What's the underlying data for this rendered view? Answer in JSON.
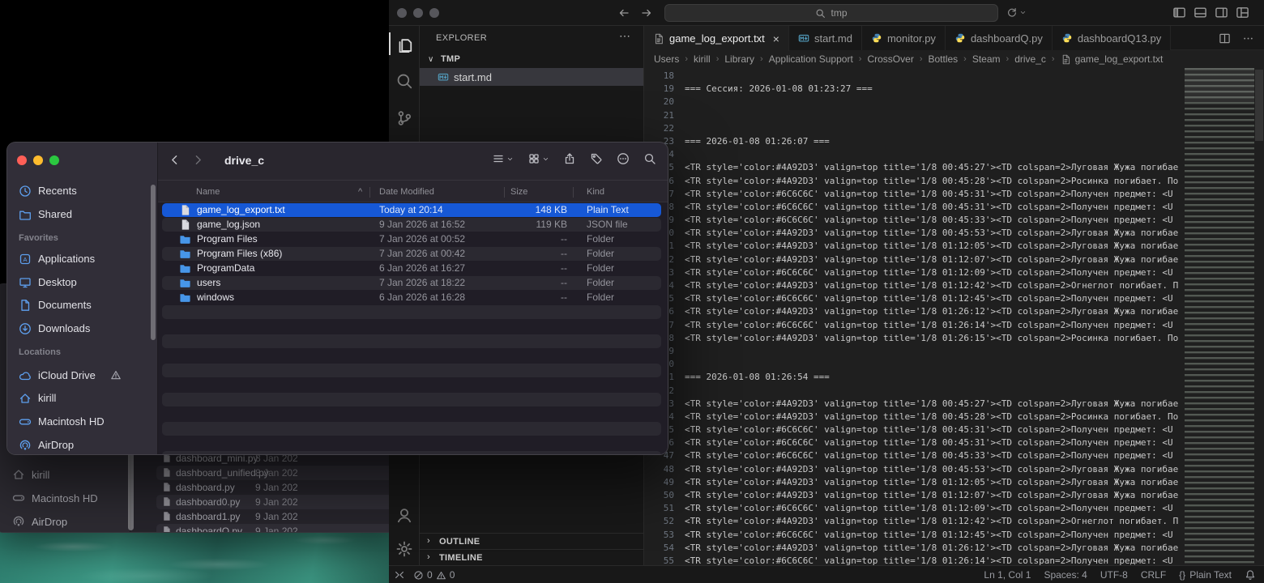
{
  "desktop": {
    "wallpaper_colors": [
      "#2f8171",
      "#3f9d89",
      "#276457"
    ]
  },
  "vscode": {
    "window_dots_color": "#56565b",
    "command_center": {
      "query": "tmp"
    },
    "explorer": {
      "title": "EXPLORER",
      "actions_glyph": "⋯",
      "section": {
        "chevron": "∨",
        "label": "TMP"
      },
      "items": [
        {
          "name": "start.md",
          "icon": "markdown",
          "selected": true
        }
      ],
      "panels": [
        {
          "label": "OUTLINE"
        },
        {
          "label": "TIMELINE"
        }
      ],
      "panel_chevron": "›"
    },
    "tabs": [
      {
        "label": "game_log_export.txt",
        "icon": "txt",
        "active": true,
        "close_glyph": "×"
      },
      {
        "label": "start.md",
        "icon": "markdown"
      },
      {
        "label": "monitor.py",
        "icon": "python"
      },
      {
        "label": "dashboardQ.py",
        "icon": "python"
      },
      {
        "label": "dashboardQ13.py",
        "icon": "python"
      }
    ],
    "breadcrumb_separator": "›",
    "breadcrumbs": [
      "Users",
      "kirill",
      "Library",
      "Application Support",
      "CrossOver",
      "Bottles",
      "Steam",
      "drive_c"
    ],
    "breadcrumb_file": {
      "label": "game_log_export.txt",
      "icon": "txt"
    },
    "editor": {
      "first_line_number": 18,
      "lines": [
        "",
        "=== Сессия: 2026-01-08 01:23:27 ===",
        "",
        "",
        "",
        "=== 2026-01-08 01:26:07 ===",
        "",
        "<TR style='color:#4A92D3' valign=top title='1/8 00:45:27'><TD colspan=2>Луговая Жужа погибае",
        "<TR style='color:#4A92D3' valign=top title='1/8 00:45:28'><TD colspan=2>Росинка погибает. По",
        "<TR style='color:#6C6C6C' valign=top title='1/8 00:45:31'><TD colspan=2>Получен предмет: <U",
        "<TR style='color:#6C6C6C' valign=top title='1/8 00:45:31'><TD colspan=2>Получен предмет: <U",
        "<TR style='color:#6C6C6C' valign=top title='1/8 00:45:33'><TD colspan=2>Получен предмет: <U",
        "<TR style='color:#4A92D3' valign=top title='1/8 00:45:53'><TD colspan=2>Луговая Жужа погибае",
        "<TR style='color:#4A92D3' valign=top title='1/8 01:12:05'><TD colspan=2>Луговая Жужа погибае",
        "<TR style='color:#4A92D3' valign=top title='1/8 01:12:07'><TD colspan=2>Луговая Жужа погибае",
        "<TR style='color:#6C6C6C' valign=top title='1/8 01:12:09'><TD colspan=2>Получен предмет: <U",
        "<TR style='color:#4A92D3' valign=top title='1/8 01:12:42'><TD colspan=2>Огнеглот погибает. П",
        "<TR style='color:#6C6C6C' valign=top title='1/8 01:12:45'><TD colspan=2>Получен предмет: <U",
        "<TR style='color:#4A92D3' valign=top title='1/8 01:26:12'><TD colspan=2>Луговая Жужа погибае",
        "<TR style='color:#6C6C6C' valign=top title='1/8 01:26:14'><TD colspan=2>Получен предмет: <U",
        "<TR style='color:#4A92D3' valign=top title='1/8 01:26:15'><TD colspan=2>Росинка погибает. По",
        "",
        "",
        "=== 2026-01-08 01:26:54 ===",
        "",
        "<TR style='color:#4A92D3' valign=top title='1/8 00:45:27'><TD colspan=2>Луговая Жужа погибае",
        "<TR style='color:#4A92D3' valign=top title='1/8 00:45:28'><TD colspan=2>Росинка погибает. По",
        "<TR style='color:#6C6C6C' valign=top title='1/8 00:45:31'><TD colspan=2>Получен предмет: <U",
        "<TR style='color:#6C6C6C' valign=top title='1/8 00:45:31'><TD colspan=2>Получен предмет: <U",
        "<TR style='color:#6C6C6C' valign=top title='1/8 00:45:33'><TD colspan=2>Получен предмет: <U",
        "<TR style='color:#4A92D3' valign=top title='1/8 00:45:53'><TD colspan=2>Луговая Жужа погибае",
        "<TR style='color:#4A92D3' valign=top title='1/8 01:12:05'><TD colspan=2>Луговая Жужа погибае",
        "<TR style='color:#4A92D3' valign=top title='1/8 01:12:07'><TD colspan=2>Луговая Жужа погибае",
        "<TR style='color:#6C6C6C' valign=top title='1/8 01:12:09'><TD colspan=2>Получен предмет: <U",
        "<TR style='color:#4A92D3' valign=top title='1/8 01:12:42'><TD colspan=2>Огнеглот погибает. П",
        "<TR style='color:#6C6C6C' valign=top title='1/8 01:12:45'><TD colspan=2>Получен предмет: <U",
        "<TR style='color:#4A92D3' valign=top title='1/8 01:26:12'><TD colspan=2>Луговая Жужа погибае",
        "<TR style='color:#6C6C6C' valign=top title='1/8 01:26:14'><TD colspan=2>Получен предмет: <U"
      ]
    },
    "status_bar": {
      "errors": "0",
      "warnings": "0",
      "cursor": "Ln 1, Col 1",
      "indent": "Spaces: 4",
      "encoding": "UTF-8",
      "eol": "CRLF",
      "language": "Plain Text",
      "language_icon": "{}"
    }
  },
  "finder": {
    "title": "drive_c",
    "traffic_lights": [
      "#ff5f57",
      "#febc2e",
      "#2bc840"
    ],
    "selection_color": "#1658d6",
    "folder_color": "#4796e8",
    "columns": {
      "name": "Name",
      "sort_glyph": "^",
      "date": "Date Modified",
      "size": "Size",
      "kind": "Kind"
    },
    "sidebar": {
      "top_items": [
        {
          "label": "Recents",
          "icon": "clock"
        },
        {
          "label": "Shared",
          "icon": "shared-folder"
        }
      ],
      "sections": [
        {
          "label": "Favorites",
          "items": [
            {
              "label": "Applications",
              "icon": "applications"
            },
            {
              "label": "Desktop",
              "icon": "desktop"
            },
            {
              "label": "Documents",
              "icon": "documents"
            },
            {
              "label": "Downloads",
              "icon": "downloads"
            }
          ]
        },
        {
          "label": "Locations",
          "items": [
            {
              "label": "iCloud Drive",
              "icon": "cloud",
              "badge": "warning"
            },
            {
              "label": "kirill",
              "icon": "home"
            },
            {
              "label": "Macintosh HD",
              "icon": "disk"
            },
            {
              "label": "AirDrop",
              "icon": "airdrop"
            }
          ]
        }
      ]
    },
    "rows": [
      {
        "name": "game_log_export.txt",
        "icon": "doc",
        "date": "Today at 20:14",
        "size": "148 KB",
        "kind": "Plain Text",
        "selected": true
      },
      {
        "name": "game_log.json",
        "icon": "doc",
        "date": "9 Jan 2026 at 16:52",
        "size": "119 KB",
        "kind": "JSON file",
        "shade": "light"
      },
      {
        "name": "Program Files",
        "icon": "folder",
        "date": "7 Jan 2026 at 00:52",
        "size": "--",
        "kind": "Folder",
        "shade": "dark"
      },
      {
        "name": "Program Files (x86)",
        "icon": "folder",
        "date": "7 Jan 2026 at 00:42",
        "size": "--",
        "kind": "Folder",
        "shade": "light"
      },
      {
        "name": "ProgramData",
        "icon": "folder",
        "date": "6 Jan 2026 at 16:27",
        "size": "--",
        "kind": "Folder",
        "shade": "dark"
      },
      {
        "name": "users",
        "icon": "folder",
        "date": "7 Jan 2026 at 18:22",
        "size": "--",
        "kind": "Folder",
        "shade": "light"
      },
      {
        "name": "windows",
        "icon": "folder",
        "date": "6 Jan 2026 at 16:28",
        "size": "--",
        "kind": "Folder",
        "shade": "dark"
      }
    ]
  },
  "finder_back": {
    "sidebar_items": [
      {
        "label": "kirill",
        "icon": "home"
      },
      {
        "label": "Macintosh HD",
        "icon": "disk"
      },
      {
        "label": "AirDrop",
        "icon": "airdrop"
      }
    ],
    "rows": [
      {
        "name": "dashboard_mini.py",
        "date": "8 Jan 202"
      },
      {
        "name": "dashboard_unified.py",
        "date": "8 Jan 202",
        "shade": "light"
      },
      {
        "name": "dashboard.py",
        "date": "9 Jan 202"
      },
      {
        "name": "dashboard0.py",
        "date": "9 Jan 202",
        "shade": "light"
      },
      {
        "name": "dashboard1.py",
        "date": "9 Jan 202"
      },
      {
        "name": "dashboardQ.py",
        "date": "9 Jan 202",
        "shade": "light"
      }
    ]
  }
}
